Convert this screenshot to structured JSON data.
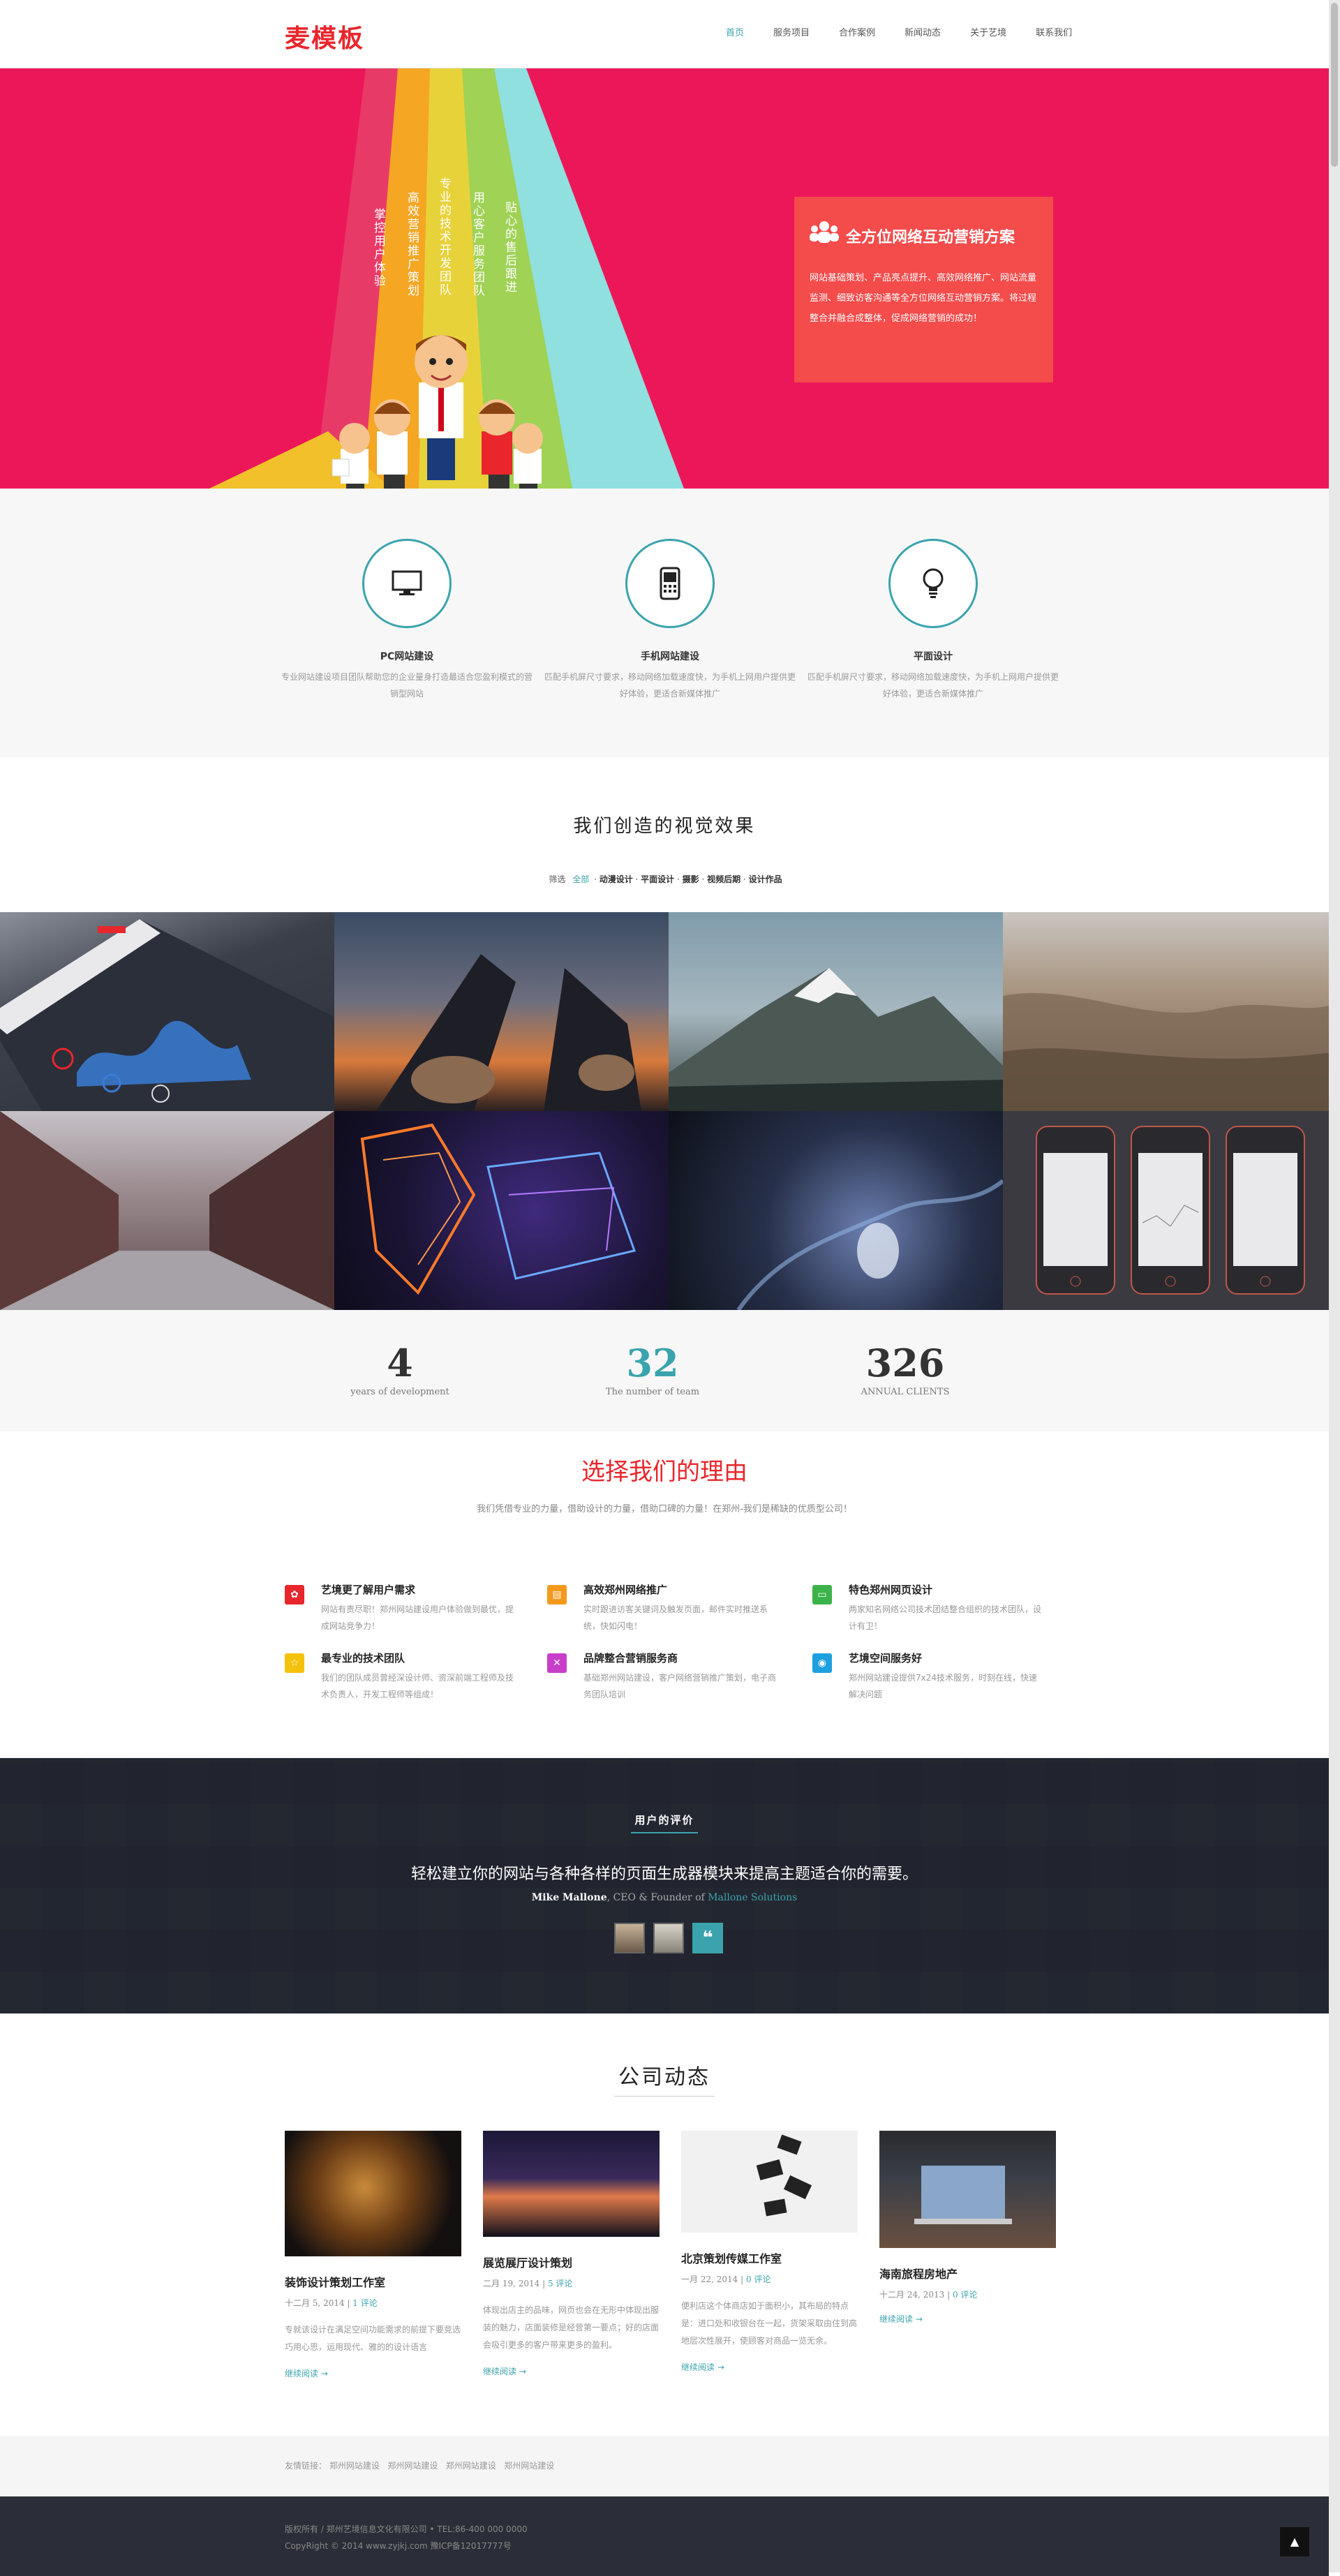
{
  "header": {
    "logo": "麦模板",
    "nav": [
      "首页",
      "服务项目",
      "合作案例",
      "新闻动态",
      "关于艺境",
      "联系我们"
    ]
  },
  "hero": {
    "ribbon_texts": [
      "掌控用户体验",
      "高效营销推广策划",
      "专业的技术开发团队",
      "用心客户服务团队",
      "贴心的售后跟进"
    ],
    "box_title": "全方位网络互动营销方案",
    "box_text": "网站基础策划、产品亮点提升、高效网络推广、网站流量监测、细致访客沟通等全方位网络互动营销方案。将过程整合并融合成整体，促成网络营销的成功！"
  },
  "services": [
    {
      "icon": "monitor-icon",
      "title": "PC网站建设",
      "text": "专业网站建设项目团队帮助您的企业量身打造最适合您盈利模式的营销型网站"
    },
    {
      "icon": "mobile-icon",
      "title": "手机网站建设",
      "text": "匹配手机屏尺寸要求，移动网络加载速度快，为手机上网用户提供更好体验，更适合新媒体推广"
    },
    {
      "icon": "lightbulb-icon",
      "title": "平面设计",
      "text": "匹配手机屏尺寸要求，移动网络加载速度快，为手机上网用户提供更好体验，更适合新媒体推广"
    }
  ],
  "portfolio": {
    "title": "我们创造的视觉效果",
    "filter_label": "筛选",
    "filters": [
      "全部",
      "动漫设计",
      "平面设计",
      "摄影",
      "视频后期",
      "设计作品"
    ]
  },
  "stats": [
    {
      "number": "4",
      "label": "years of development",
      "color": "#333333"
    },
    {
      "number": "32",
      "label": "The number of team",
      "color": "#3aa3ad"
    },
    {
      "number": "326",
      "label": "ANNUAL CLIENTS",
      "color": "#333333"
    }
  ],
  "why": {
    "title": "选择我们的理由",
    "subtitle": "我们凭借专业的力量，借助设计的力量，借助口碑的力量！在郑州-我们是稀缺的优质型公司！",
    "features": [
      {
        "icon": "users-icon",
        "color": "#e8262c",
        "title": "艺境更了解用户需求",
        "text": "网站有责尽职！郑州网站建设用户体验做到最优，提成网站竞争力！"
      },
      {
        "icon": "chart-icon",
        "color": "#f39a1d",
        "title": "高效郑州网络推广",
        "text": "实时跟进访客关键词及触发页面，邮件实时推送系统，快如闪电！"
      },
      {
        "icon": "monitor-icon",
        "color": "#3cb34a",
        "title": "特色郑州网页设计",
        "text": "两家知名网络公司技术团结整合组织的技术团队，设计有卫！"
      },
      {
        "icon": "star-icon",
        "color": "#f4c20d",
        "title": "最专业的技术团队",
        "text": "我们的团队成员曾经深设计师、资深前端工程师及技术负责人，开发工程师等组成！"
      },
      {
        "icon": "cross-icon",
        "color": "#c83ec8",
        "title": "品牌整合营销服务商",
        "text": "基础郑州网站建设，客户网络营销推广策划，电子商务团队培训"
      },
      {
        "icon": "eye-icon",
        "color": "#1e9fe0",
        "title": "艺境空间服务好",
        "text": "郑州网站建设提供7x24技术服务，时刻在线，快速解决问题"
      }
    ]
  },
  "testimonial": {
    "title": "用户的评价",
    "quote": "轻松建立你的网站与各种各样的页面生成器模块来提高主题适合你的需要。",
    "name": "Mike Mallone",
    "role": ", CEO & Founder of ",
    "company": "Mallone Solutions",
    "quote_icon": "quote-icon"
  },
  "news": {
    "title": "公司动态",
    "posts": [
      {
        "title": "装饰设计策划工作室",
        "date": "十二月 5, 2014",
        "comments": "1 评论",
        "text": "专就该设计在满足空间功能需求的前提下要竞选巧用心思，运用现代、雅的的设计语言",
        "more": "继续阅读 →"
      },
      {
        "title": "展览展厅设计策划",
        "date": "二月 19, 2014",
        "comments": "5 评论",
        "text": "体现出店主的品味，网页也会在无形中体现出服装的魅力，店面装修是经营第一要点；好的店面会吸引更多的客户带来更多的盈利。",
        "more": "继续阅读 →"
      },
      {
        "title": "北京策划传媒工作室",
        "date": "一月 22, 2014",
        "comments": "0 评论",
        "text": "便利店这个体商店如于面积小，其布局的特点是：进口处和收银台在一起，货架采取由住到高地层次性展开，使顾客对商品一览无余。",
        "more": "继续阅读 →"
      },
      {
        "title": "海南旅程房地产",
        "date": "十二月 24, 2013",
        "comments": "0 评论",
        "text": "",
        "more": "继续阅读 →"
      }
    ]
  },
  "links": {
    "label": "友情链接：",
    "items": [
      "郑州网站建设",
      "郑州网站建设",
      "郑州网站建设",
      "郑州网站建设"
    ]
  },
  "footer": {
    "line1": "版权所有 / 郑州艺境信息文化有限公司 • TEL:86-400 000 0000",
    "line2": "CopyRight © 2014 www.zyjkj.com 豫ICP备12017777号",
    "totop_icon": "arrow-up-icon"
  }
}
